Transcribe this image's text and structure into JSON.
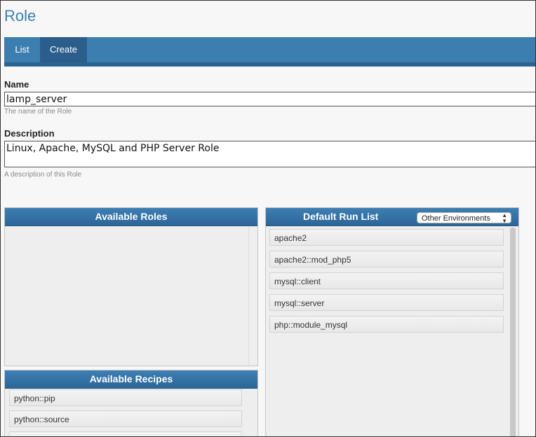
{
  "page": {
    "title": "Role"
  },
  "tabs": [
    {
      "label": "List"
    },
    {
      "label": "Create"
    }
  ],
  "form": {
    "name": {
      "label": "Name",
      "value": "lamp_server",
      "hint": "The name of the Role"
    },
    "description": {
      "label": "Description",
      "value": "Linux, Apache, MySQL and PHP Server Role",
      "hint": "A description of this Role"
    }
  },
  "available_roles": {
    "title": "Available Roles",
    "items": []
  },
  "available_recipes": {
    "title": "Available Recipes",
    "items": [
      "python::pip",
      "python::source"
    ]
  },
  "run_list": {
    "title": "Default Run List",
    "environment_select": "Other Environments",
    "items": [
      "apache2",
      "apache2::mod_php5",
      "mysql::client",
      "mysql::server",
      "php::module_mysql"
    ]
  }
}
